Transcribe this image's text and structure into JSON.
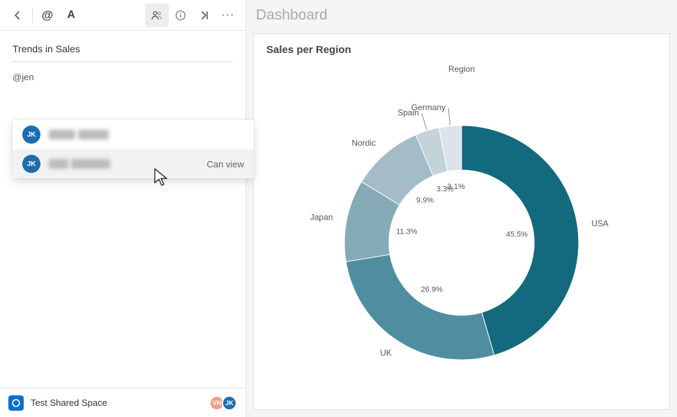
{
  "toolbar": {
    "back": "‹",
    "mention": "@",
    "format": "A",
    "people": "people",
    "info": "i",
    "skip": "›|",
    "more": "···"
  },
  "panel": {
    "title": "Trends in Sales",
    "mention_text": "@jen"
  },
  "dropdown": {
    "items": [
      {
        "initials": "JK",
        "permission": ""
      },
      {
        "initials": "JK",
        "permission": "Can view"
      }
    ]
  },
  "footer": {
    "space_name": "Test Shared Space",
    "avatars": [
      {
        "initials": "VN",
        "color": "#f69a8a"
      },
      {
        "initials": "JK",
        "color": "#1a6db0"
      }
    ]
  },
  "right": {
    "header": "Dashboard",
    "card_title": "Sales per Region",
    "legend_title": "Region"
  },
  "chart_data": {
    "type": "pie",
    "title": "Sales per Region",
    "legend_title": "Region",
    "series": [
      {
        "name": "USA",
        "value": 45.5,
        "color": "#13697d"
      },
      {
        "name": "UK",
        "value": 26.9,
        "color": "#4e8ea0"
      },
      {
        "name": "Japan",
        "value": 11.3,
        "color": "#86aab6"
      },
      {
        "name": "Nordic",
        "value": 9.9,
        "color": "#a4bcc7"
      },
      {
        "name": "Spain",
        "value": 3.3,
        "color": "#c4d2da"
      },
      {
        "name": "Germany",
        "value": 3.1,
        "color": "#dde4e9"
      }
    ],
    "inner_radius_pct": 62
  }
}
